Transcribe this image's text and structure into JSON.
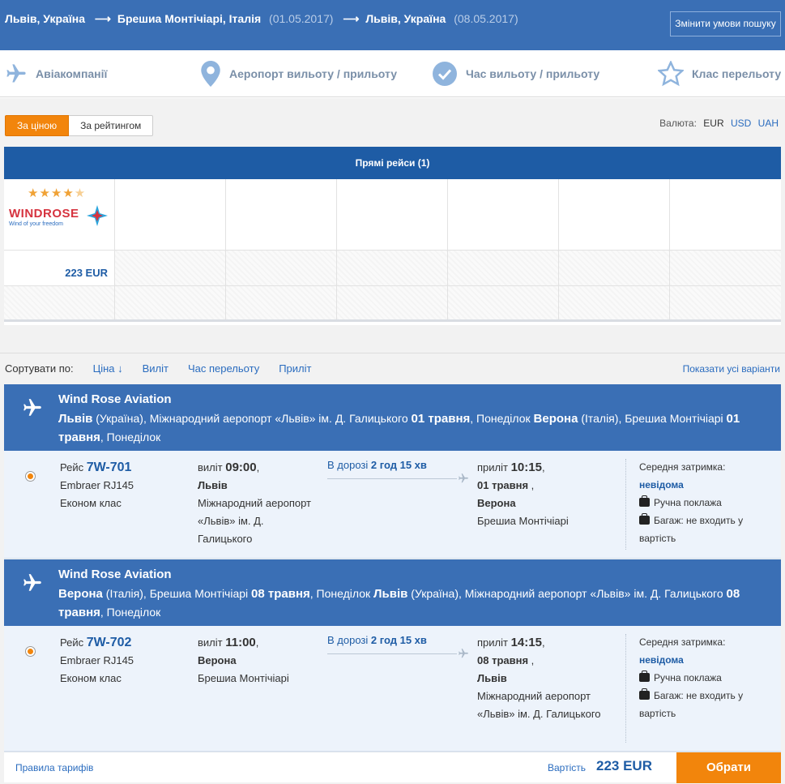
{
  "header": {
    "origin": "Львів, Україна",
    "destination": "Брешиа Монтічіарі, Італія",
    "depart_date": "(01.05.2017)",
    "return_city": "Львів, Україна",
    "return_date": "(08.05.2017)",
    "change_button": "Змінити умови пошуку",
    "arrow": "⟶"
  },
  "filters": [
    {
      "label": "Авіакомпанії",
      "icon": "plane-icon"
    },
    {
      "label": "Аеропорт вильоту / прильоту",
      "icon": "map-pin-icon"
    },
    {
      "label": "Час вильоту / прильоту",
      "icon": "check-circle-icon"
    },
    {
      "label": "Клас перельоту",
      "icon": "star-icon"
    }
  ],
  "sort_tabs": {
    "by_price": "За ціною",
    "by_rating": "За рейтингом"
  },
  "currency": {
    "label": "Валюта:",
    "options": [
      "EUR",
      "USD",
      "UAH"
    ],
    "active": "EUR"
  },
  "matrix": {
    "title": "Прямі рейси (1)",
    "airline": {
      "rating_stars": 4.5,
      "stars": "★★★★",
      "half_star": "★",
      "logo_text": "WINDROSE",
      "logo_tagline": "Wind of your freedom"
    },
    "price": "223 EUR"
  },
  "sortbar": {
    "label": "Сортувати по:",
    "links": [
      "Ціна ↓",
      "Виліт",
      "Час перельоту",
      "Приліт"
    ],
    "show_all": "Показати усі варіанти"
  },
  "segments": [
    {
      "airline": "Wind Rose Aviation",
      "route_from_city": "Львів",
      "route_from_country": "(Україна)",
      "route_from_airport": ", Міжнародний аеропорт «Львів» ім. Д. Галицького",
      "route_from_date": "01 травня",
      "route_from_day": ", Понеділок",
      "route_to_city": "Верона",
      "route_to_country": "(Італія)",
      "route_to_airport": ", Брешиа Монтічіарі",
      "route_to_date": "01 травня",
      "route_to_day": ", Понеділок",
      "flight_label": "Рейс",
      "flight_number": "7W-701",
      "aircraft": "Embraer RJ145",
      "class": "Економ клас",
      "dep_label": "виліт",
      "dep_time": "09:00",
      "dep_city": "Львів",
      "dep_airport": "Міжнародний аеропорт «Львів» ім. Д. Галицького",
      "duration_label": "В дорозі",
      "duration": "2 год 15 хв",
      "arr_label": "приліт",
      "arr_time": "10:15",
      "arr_date": "01 травня",
      "arr_city": "Верона",
      "arr_airport": "Брешиа Монтічіарі",
      "delay_label": "Середня затримка:",
      "delay_value": "невідома",
      "hand_luggage": "Ручна поклажа",
      "baggage": "Багаж: не входить у вартість"
    },
    {
      "airline": "Wind Rose Aviation",
      "route_from_city": "Верона",
      "route_from_country": "(Італія)",
      "route_from_airport": ", Брешиа Монтічіарі",
      "route_from_date": "08 травня",
      "route_from_day": ", Понеділок",
      "route_to_city": "Львів",
      "route_to_country": "(Україна)",
      "route_to_airport": ", Міжнародний аеропорт «Львів» ім. Д. Галицького",
      "route_to_date": "08 травня",
      "route_to_day": ", Понеділок",
      "flight_label": "Рейс",
      "flight_number": "7W-702",
      "aircraft": "Embraer RJ145",
      "class": "Економ клас",
      "dep_label": "виліт",
      "dep_time": "11:00",
      "dep_city": "Верона",
      "dep_airport": "Брешиа Монтічіарі",
      "duration_label": "В дорозі",
      "duration": "2 год 15 хв",
      "arr_label": "приліт",
      "arr_time": "14:15",
      "arr_date": "08 травня",
      "arr_city": "Львів",
      "arr_airport": "Міжнародний аеропорт «Львів» ім. Д. Галицького",
      "delay_label": "Середня затримка:",
      "delay_value": "невідома",
      "hand_luggage": "Ручна поклажа",
      "baggage": "Багаж: не входить у вартість"
    }
  ],
  "footer": {
    "rules": "Правила тарифів",
    "price_label": "Вартість",
    "price": "223 EUR",
    "book_button": "Обрати"
  },
  "colors": {
    "header_bg": "#3a6fb5",
    "accent": "#f2850c",
    "link": "#2a6cbf"
  }
}
